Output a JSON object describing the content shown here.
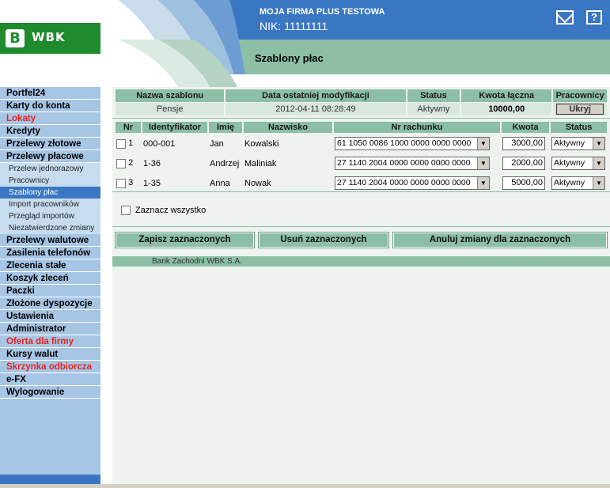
{
  "header": {
    "company": "MOJA FIRMA PLUS TESTOWA",
    "nik": "NIK: 11111111",
    "page_title": "Szablony płac",
    "logo_text": "WBK",
    "logo_mark": "B",
    "help_label": "?"
  },
  "sidebar": {
    "items": [
      {
        "label": "Portfel24"
      },
      {
        "label": "Karty do konta"
      },
      {
        "label": "Lokaty",
        "color": "#e8231f"
      },
      {
        "label": "Kredyty"
      },
      {
        "label": "Przelewy złotowe"
      },
      {
        "label": "Przelewy płacowe"
      },
      {
        "label": "Przelewy walutowe"
      },
      {
        "label": "Zasilenia telefonów"
      },
      {
        "label": "Zlecenia stałe"
      },
      {
        "label": "Koszyk zleceń"
      },
      {
        "label": "Paczki"
      },
      {
        "label": "Złożone dyspozycje"
      },
      {
        "label": "Ustawienia"
      },
      {
        "label": "Administrator"
      },
      {
        "label": "Oferta dla firmy",
        "color": "#e8231f"
      },
      {
        "label": "Kursy walut"
      },
      {
        "label": "Skrzynka odbiorcza",
        "color": "#e8231f"
      },
      {
        "label": "e-FX"
      },
      {
        "label": "Wylogowanie"
      }
    ],
    "subitems": [
      {
        "label": "Przelew jednorazowy"
      },
      {
        "label": "Pracownicy"
      },
      {
        "label": "Szablony płac",
        "active": true
      },
      {
        "label": "Import pracowników"
      },
      {
        "label": "Przegląd importów"
      },
      {
        "label": "Niezatwierdzone zmiany"
      }
    ]
  },
  "template": {
    "headers": [
      "Nazwa szablonu",
      "Data ostatniej modyfikacji",
      "Status",
      "Kwota łączna",
      "Pracownicy"
    ],
    "name": "Pensje",
    "modified": "2012-04-11 08:28:49",
    "status": "Aktywny",
    "total": "10000,00",
    "toggle_button": "Ukryj"
  },
  "employees": {
    "headers": [
      "Nr",
      "Identyfikator",
      "Imię",
      "Nazwisko",
      "Nr rachunku",
      "Kwota",
      "Status"
    ],
    "rows": [
      {
        "nr": "1",
        "id": "000-001",
        "first": "Jan",
        "last": "Kowalski",
        "account": "61 1050 0086 1000 0000 0000 0000",
        "amount": "3000,00",
        "status": "Aktywny"
      },
      {
        "nr": "2",
        "id": "1-36",
        "first": "Andrzej",
        "last": "Maliniak",
        "account": "27 1140 2004 0000 0000 0000 0000",
        "amount": "2000,00",
        "status": "Aktywny"
      },
      {
        "nr": "3",
        "id": "1-35",
        "first": "Anna",
        "last": "Nowak",
        "account": "27 1140 2004 0000 0000 0000 0000",
        "amount": "5000,00",
        "status": "Aktywny"
      }
    ]
  },
  "select_all_label": "Zaznacz wszystko",
  "buttons": {
    "save": "Zapisz zaznaczonych",
    "delete": "Usuń zaznaczonych",
    "cancel": "Anuluj zmiany dla zaznaczonych"
  },
  "footer": "Bank Zachodni WBK S.A.",
  "colors": {
    "accent_blue": "#3a77c2",
    "accent_green": "#8cbfa5",
    "logo_green": "#1f8a2e",
    "alert_red": "#e8231f"
  }
}
